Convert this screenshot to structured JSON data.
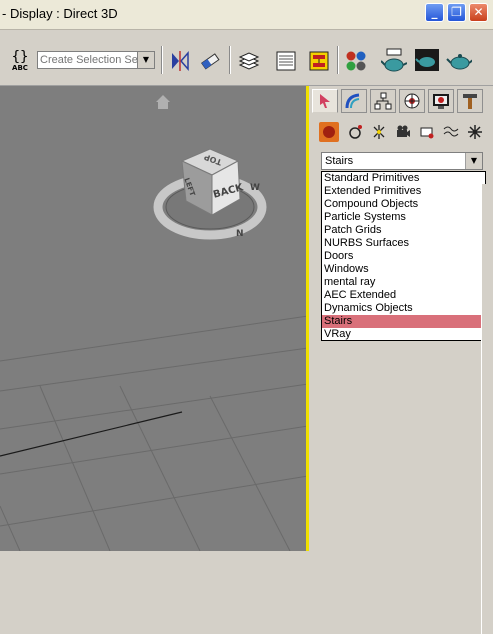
{
  "window": {
    "title": "- Display : Direct 3D",
    "minimize": "_",
    "restore": "❐",
    "close": "✕"
  },
  "toolbar": {
    "abc_label": "ABC",
    "selection_set_placeholder": "Create Selection Set"
  },
  "viewcube": {
    "top_label": "TOP",
    "back_label": "BACK",
    "left_label": "LEFT",
    "compass_w": "W",
    "compass_n": "N"
  },
  "command_panel": {
    "category_selected": "Stairs",
    "category_options": [
      "Standard Primitives",
      "Extended Primitives",
      "Compound Objects",
      "Particle Systems",
      "Patch Grids",
      "NURBS Surfaces",
      "Doors",
      "Windows",
      "mental ray",
      "AEC Extended",
      "Dynamics Objects",
      "Stairs",
      "VRay"
    ]
  },
  "colors": {
    "viewport_bg": "#7e7e7e",
    "active_viewport_border": "#f0e000",
    "selected_option": "#d9707a"
  }
}
